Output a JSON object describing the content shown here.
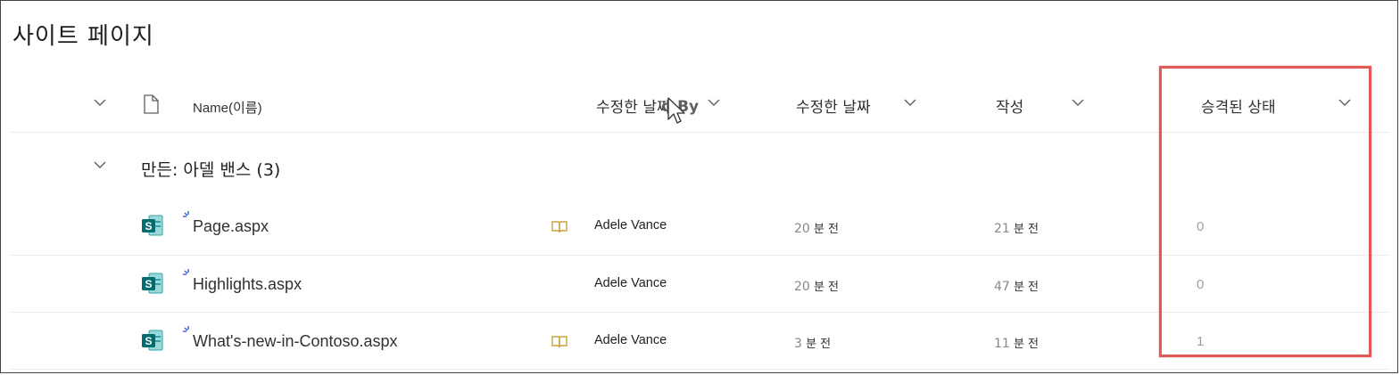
{
  "page": {
    "title": "사이트 페이지"
  },
  "columns": {
    "name": "Name(이름)",
    "modified_by": "수정한 날짜",
    "drag_ghost": "d By",
    "modified": "수정한 날짜",
    "created": "작성",
    "promoted_state": "승격된 상태"
  },
  "group": {
    "label": "만든: 아델 밴스 (3)"
  },
  "rows": [
    {
      "name": "Page.aspx",
      "author": "Adele Vance",
      "modified_num": "20",
      "modified_unit": "분 전",
      "created_num": "21",
      "created_unit": "분 전",
      "status": "0",
      "has_book_icon": true
    },
    {
      "name": "Highlights.aspx",
      "author": "Adele Vance",
      "modified_num": "20",
      "modified_unit": "분 전",
      "created_num": "47",
      "created_unit": "분 전",
      "status": "0",
      "has_book_icon": false
    },
    {
      "name": "What's-new-in-Contoso.aspx",
      "author": "Adele Vance",
      "modified_num": "3",
      "modified_unit": "분 전",
      "created_num": "11",
      "created_unit": "분 전",
      "status": "1",
      "has_book_icon": true
    }
  ],
  "icons": {
    "collapse": "chevron-down-icon",
    "file_type": "document-icon",
    "sharepoint_page": "sharepoint-page-icon",
    "new_item": "new-item-sparkle-icon",
    "book": "book-icon",
    "cursor": "mouse-pointer-icon"
  },
  "colors": {
    "highlight": "#e05a5a",
    "sharepoint": "#036c70",
    "book": "#c8a23a"
  }
}
